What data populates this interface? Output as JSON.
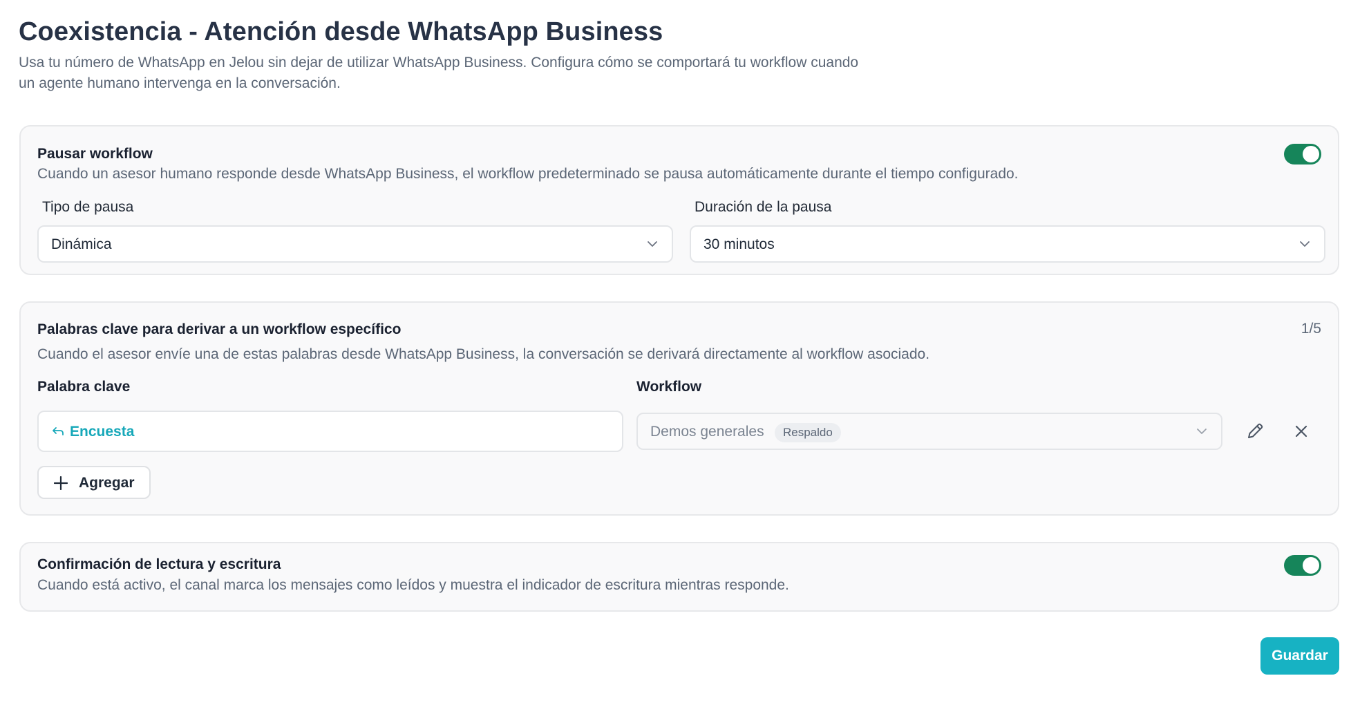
{
  "page": {
    "title": "Coexistencia - Atención desde WhatsApp Business",
    "description": "Usa tu número de WhatsApp en Jelou sin dejar de utilizar WhatsApp Business. Configura cómo se comportará tu workflow cuando un agente humano intervenga en la conversación."
  },
  "pause_section": {
    "title": "Pausar workflow",
    "description": "Cuando un asesor humano responde desde WhatsApp Business, el workflow predeterminado se pausa automáticamente durante el tiempo configurado.",
    "enabled": true,
    "pause_type_label": "Tipo de pausa",
    "pause_type_value": "Dinámica",
    "duration_label": "Duración de la pausa",
    "duration_value": "30 minutos"
  },
  "keywords_section": {
    "title": "Palabras clave para derivar a un workflow específico",
    "counter": "1/5",
    "description": "Cuando el asesor envíe una de estas palabras desde WhatsApp Business, la conversación se derivará directamente al workflow asociado.",
    "keyword_col_label": "Palabra clave",
    "workflow_col_label": "Workflow",
    "rows": [
      {
        "keyword": "Encuesta",
        "workflow": "Demos generales",
        "badge": "Respaldo"
      }
    ],
    "add_label": "Agregar"
  },
  "read_receipts_section": {
    "title": "Confirmación de lectura y escritura",
    "description": "Cuando está activo, el canal marca los mensajes como leídos y muestra el indicador de escritura mientras responde.",
    "enabled": true
  },
  "actions": {
    "save_label": "Guardar"
  },
  "colors": {
    "toggle_on": "#16855a",
    "accent": "#17b2c3",
    "keyword_text": "#17a8b9"
  }
}
